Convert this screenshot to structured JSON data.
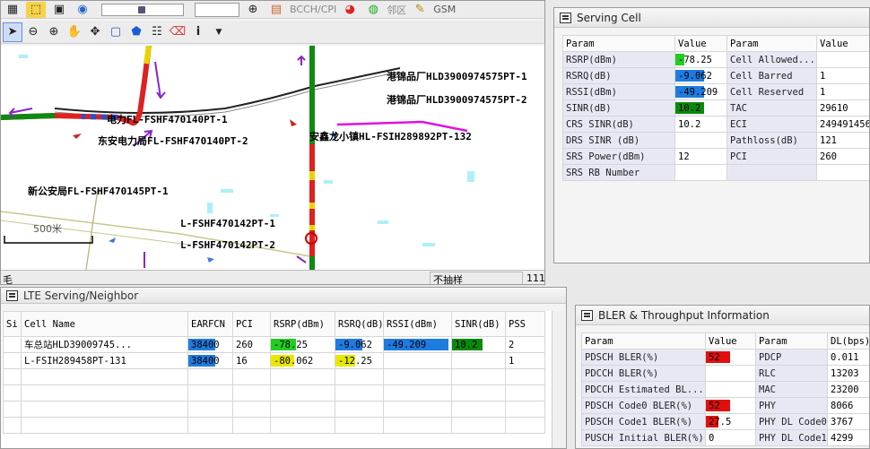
{
  "toolbar": {
    "measure_label": "BCCH/CPI",
    "neighbor_label": "邻区",
    "network_label": "GSM"
  },
  "map": {
    "labels": [
      "港锦品厂HLD3900974575PT-1",
      "港锦品厂HLD3900974575PT-2",
      "电力FL-FSHF470140PT-1",
      "东安电力局FL-FSHF470140PT-2",
      "安鑫龙小镇HL-FSIH289892PT-132",
      "新公安局FL-FSHF470145PT-1",
      "L-FSHF470142PT-1",
      "L-FSHF470142PT-2"
    ],
    "scale_label": "500米"
  },
  "status": {
    "left": "毛",
    "mid": "不抽样",
    "right": "111"
  },
  "serving": {
    "title": "Serving Cell",
    "headers": [
      "Param",
      "Value",
      "Param",
      "Value"
    ],
    "rows": [
      {
        "p1": "RSRP(dBm)",
        "v1": "-78.25",
        "p2": "Cell Allowed...",
        "v2": ""
      },
      {
        "p1": "RSRQ(dB)",
        "v1": "-9.062",
        "p2": "Cell Barred",
        "v2": "1"
      },
      {
        "p1": "RSSI(dBm)",
        "v1": "-49.209",
        "p2": "Cell Reserved",
        "v2": "1"
      },
      {
        "p1": "SINR(dB)",
        "v1": "10.2",
        "p2": "TAC",
        "v2": "29610"
      },
      {
        "p1": "CRS SINR(dB)",
        "v1": "10.2",
        "p2": "ECI",
        "v2": "249491456"
      },
      {
        "p1": "DRS SINR (dB)",
        "v1": "",
        "p2": "Pathloss(dB)",
        "v2": "121"
      },
      {
        "p1": "SRS Power(dBm)",
        "v1": "12",
        "p2": "PCI",
        "v2": "260"
      },
      {
        "p1": "SRS RB Number",
        "v1": "",
        "p2": "",
        "v2": ""
      }
    ],
    "bar_colors": [
      "#22cc22",
      "#1e7be0",
      "#1e7be0",
      "#0a8a0a"
    ]
  },
  "lte": {
    "title": "LTE Serving/Neighbor",
    "headers": [
      "Si Na",
      "Cell Name",
      "EARFCN",
      "PCI",
      "RSRP(dBm)",
      "RSRQ(dB)",
      "RSSI(dBm)",
      "SINR(dB)",
      "PSS"
    ],
    "rows": [
      {
        "si": "",
        "cell": "车总站HLD39009745...",
        "earfcn": "38400",
        "pci": "260",
        "rsrp": "-78.25",
        "rsrq": "-9.062",
        "rssi": "-49.209",
        "sinr": "10.2",
        "pss": "2"
      },
      {
        "si": "",
        "cell": "L-FSIH289458PT-131",
        "earfcn": "38400",
        "pci": "16",
        "rsrp": "-80.062",
        "rsrq": "-12.25",
        "rssi": "",
        "sinr": "",
        "pss": "1"
      }
    ]
  },
  "bler": {
    "title": "BLER & Throughput Information",
    "headers": [
      "Param",
      "Value",
      "Param",
      "DL(bps)"
    ],
    "rows": [
      {
        "p1": "PDSCH BLER(%)",
        "v1": "52",
        "p2": "PDCP",
        "v2": "0.011"
      },
      {
        "p1": "PDCCH BLER(%)",
        "v1": "",
        "p2": "RLC",
        "v2": "13203"
      },
      {
        "p1": "PDCCH Estimated BL...",
        "v1": "",
        "p2": "MAC",
        "v2": "23200"
      },
      {
        "p1": "PDSCH Code0 BLER(%)",
        "v1": "52",
        "p2": "PHY",
        "v2": "8066"
      },
      {
        "p1": "PDSCH Code1 BLER(%)",
        "v1": "27.5",
        "p2": "PHY DL Code0",
        "v2": "3767"
      },
      {
        "p1": "PUSCH Initial BLER(%)",
        "v1": "0",
        "p2": "PHY DL Code1",
        "v2": "4299"
      }
    ]
  }
}
